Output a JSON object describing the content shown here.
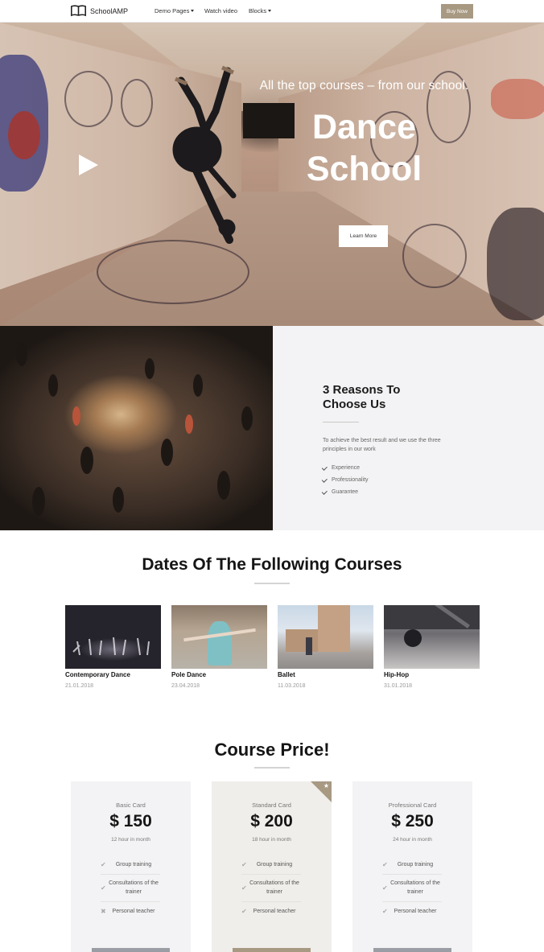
{
  "nav": {
    "brand": "SchoolAMP",
    "links": [
      {
        "label": "Demo Pages",
        "dropdown": true
      },
      {
        "label": "Watch video",
        "dropdown": false
      },
      {
        "label": "Blocks",
        "dropdown": true
      }
    ],
    "buy_label": "Buy Now"
  },
  "hero": {
    "subtitle": "All the top courses – from our school.",
    "title_line1": "Dance",
    "title_line2": "School",
    "cta": "Learn More",
    "icon": "play-icon"
  },
  "reasons": {
    "title_line1": "3 Reasons To",
    "title_line2": "Choose Us",
    "description": "To achieve the best result and we use the three principles in our work",
    "items": [
      "Experience",
      "Professionality",
      "Guarantee"
    ]
  },
  "courses": {
    "title": "Dates Of The Following Courses",
    "items": [
      {
        "name": "Contemporary Dance",
        "date": "21.01.2018"
      },
      {
        "name": "Pole Dance",
        "date": "23.04.2018"
      },
      {
        "name": "Ballet",
        "date": "11.03.2018"
      },
      {
        "name": "Hip-Hop",
        "date": "31.01.2018"
      }
    ]
  },
  "pricing": {
    "title": "Course Price!",
    "cards": [
      {
        "label": "Basic Card",
        "price": "$ 150",
        "period": "12 hour in month",
        "featured": false,
        "features": [
          {
            "text": "Group training",
            "included": true
          },
          {
            "text": "Consultations of the trainer",
            "included": true
          },
          {
            "text": "Personal teacher",
            "included": false
          }
        ]
      },
      {
        "label": "Standard Card",
        "price": "$ 200",
        "period": "18 hour in month",
        "featured": true,
        "features": [
          {
            "text": "Group training",
            "included": true
          },
          {
            "text": "Consultations of the trainer",
            "included": true
          },
          {
            "text": "Personal teacher",
            "included": true
          }
        ]
      },
      {
        "label": "Professional Card",
        "price": "$ 250",
        "period": "24 hour in month",
        "featured": false,
        "features": [
          {
            "text": "Group training",
            "included": true
          },
          {
            "text": "Consultations of the trainer",
            "included": true
          },
          {
            "text": "Personal teacher",
            "included": true
          }
        ]
      }
    ]
  },
  "colors": {
    "accent": "#a89983",
    "section_bg": "#f3f3f5",
    "featured_bg": "#f0eeea"
  }
}
